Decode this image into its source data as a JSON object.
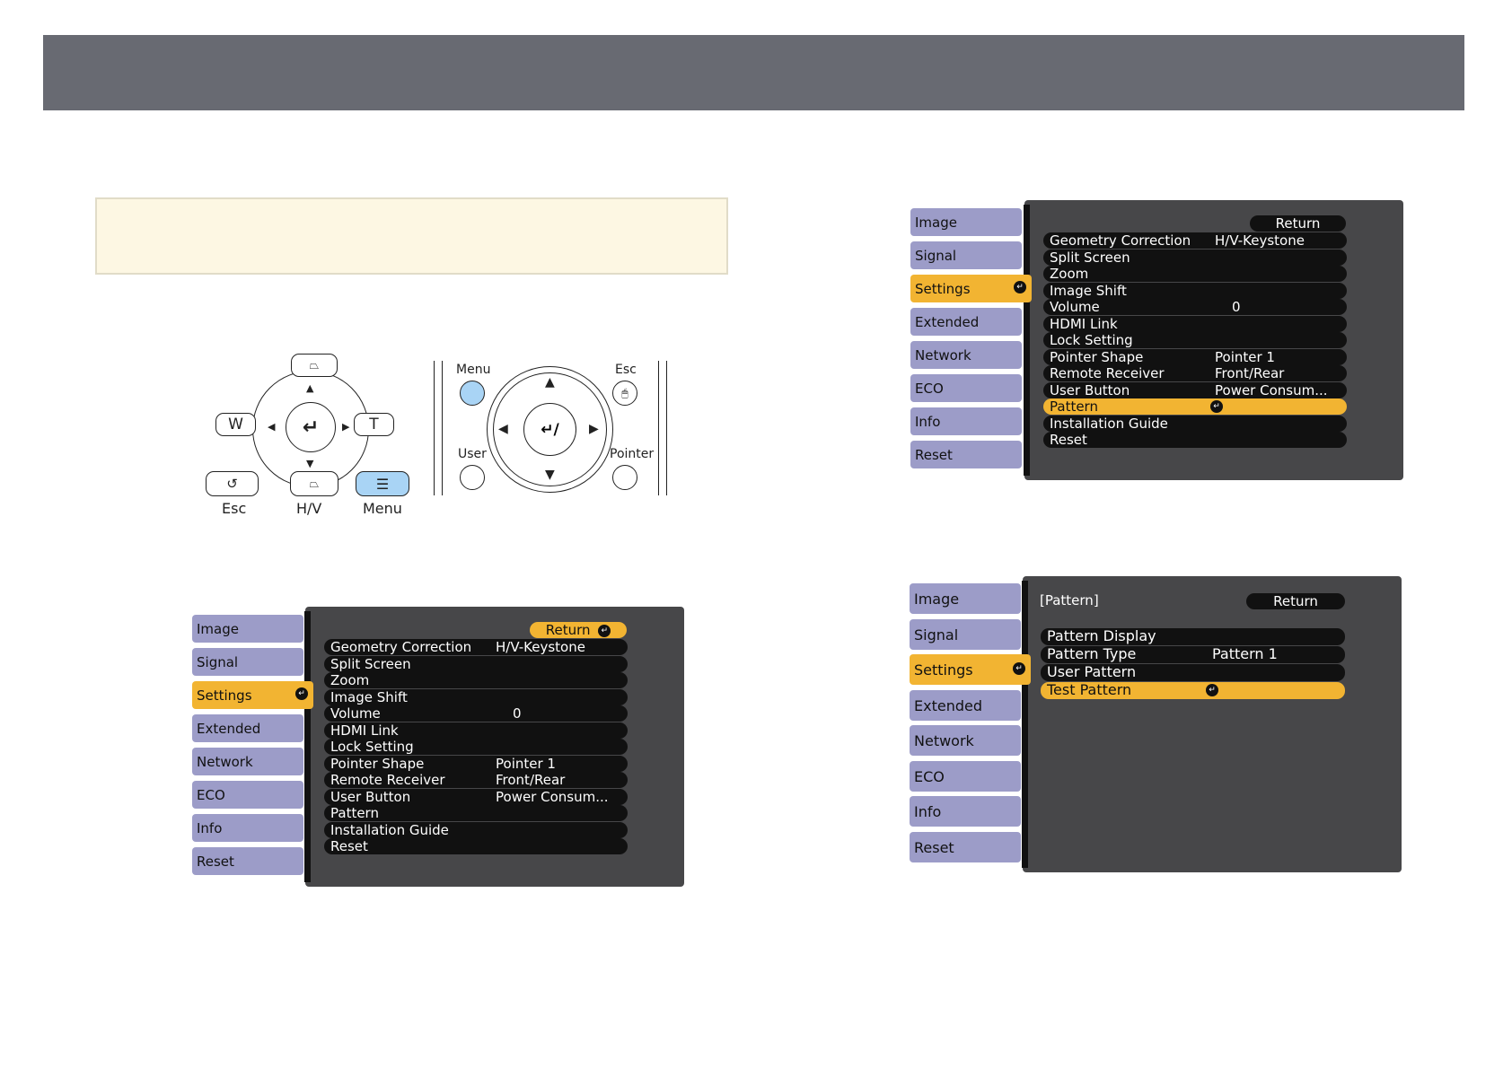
{
  "remote_left": {
    "labels": {
      "w": "W",
      "t": "T",
      "esc": "Esc",
      "hv": "H/V",
      "menu": "Menu"
    }
  },
  "remote_right": {
    "labels": {
      "menu": "Menu",
      "esc": "Esc",
      "user": "User",
      "pointer": "Pointer"
    }
  },
  "colors": {
    "tab": "#9c9cc8",
    "selected": "#f2b432",
    "panel": "#474749",
    "row": "#111111",
    "menu_highlight": "#a9d4f5"
  },
  "menu_settings": {
    "tabs": [
      "Image",
      "Signal",
      "Settings",
      "Extended",
      "Network",
      "ECO",
      "Info",
      "Reset"
    ],
    "selected_tab": "Settings",
    "return_label": "Return",
    "rows": [
      {
        "label": "Geometry Correction",
        "value": "H/V-Keystone"
      },
      {
        "label": "Split Screen",
        "value": ""
      },
      {
        "label": "Zoom",
        "value": ""
      },
      {
        "label": "Image Shift",
        "value": ""
      },
      {
        "label": "Volume",
        "value": "0"
      },
      {
        "label": "HDMI Link",
        "value": ""
      },
      {
        "label": "Lock Setting",
        "value": ""
      },
      {
        "label": "Pointer Shape",
        "value": "Pointer 1"
      },
      {
        "label": "Remote Receiver",
        "value": "Front/Rear"
      },
      {
        "label": "User Button",
        "value": "Power Consum..."
      },
      {
        "label": "Pattern",
        "value": ""
      },
      {
        "label": "Installation Guide",
        "value": ""
      },
      {
        "label": "Reset",
        "value": ""
      }
    ]
  },
  "menu_pattern": {
    "tabs": [
      "Image",
      "Signal",
      "Settings",
      "Extended",
      "Network",
      "ECO",
      "Info",
      "Reset"
    ],
    "selected_tab": "Settings",
    "title": "[Pattern]",
    "return_label": "Return",
    "rows": [
      {
        "label": "Pattern Display",
        "value": ""
      },
      {
        "label": "Pattern Type",
        "value": "Pattern 1"
      },
      {
        "label": "User Pattern",
        "value": ""
      },
      {
        "label": "Test Pattern",
        "value": ""
      }
    ]
  }
}
